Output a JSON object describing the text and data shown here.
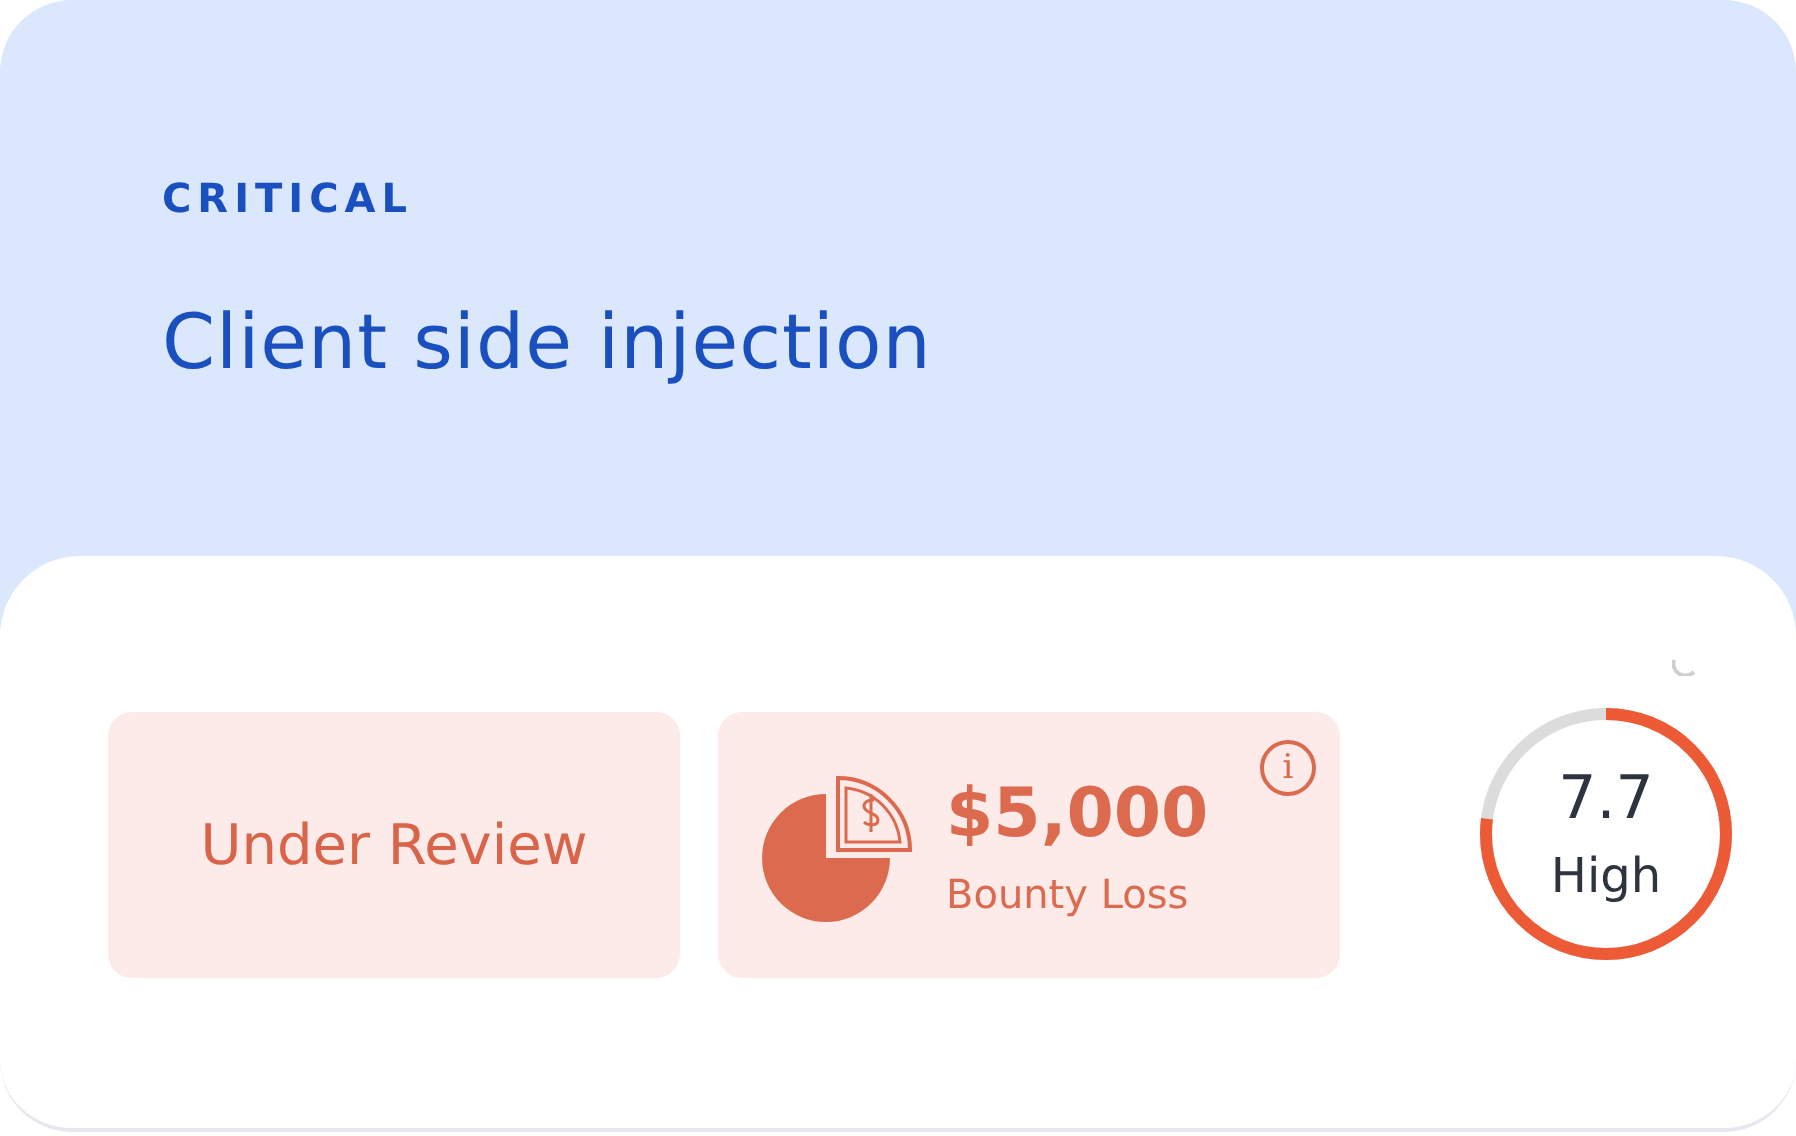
{
  "severity": "CRITICAL",
  "title": "Client side injection",
  "status": {
    "label": "Under Review"
  },
  "bounty": {
    "amount": "$5,000",
    "label": "Bounty Loss",
    "info_icon": "i"
  },
  "score": {
    "value": "7.7",
    "rating": "High",
    "level": 0.77
  }
}
